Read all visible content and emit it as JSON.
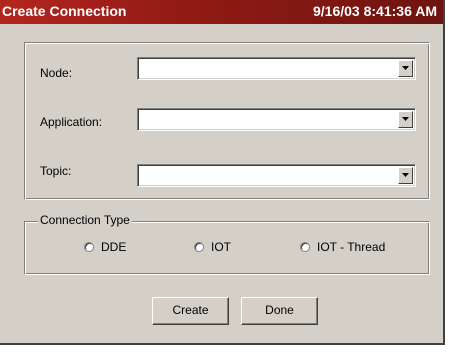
{
  "window": {
    "title": "Create Connection",
    "timestamp": "9/16/03 8:41:36 AM",
    "accent_color": "#a01f18"
  },
  "fields": {
    "node": {
      "label": "Node:",
      "value": ""
    },
    "application": {
      "label": "Application:",
      "value": ""
    },
    "topic": {
      "label": "Topic:",
      "value": ""
    },
    "dropdown_icon": "chevron-down-icon"
  },
  "connection_type": {
    "legend": "Connection Type",
    "options": [
      {
        "label": "DDE",
        "selected": false
      },
      {
        "label": "IOT",
        "selected": false
      },
      {
        "label": "IOT - Thread",
        "selected": false
      }
    ]
  },
  "buttons": {
    "create_label": "Create",
    "done_label": "Done"
  }
}
